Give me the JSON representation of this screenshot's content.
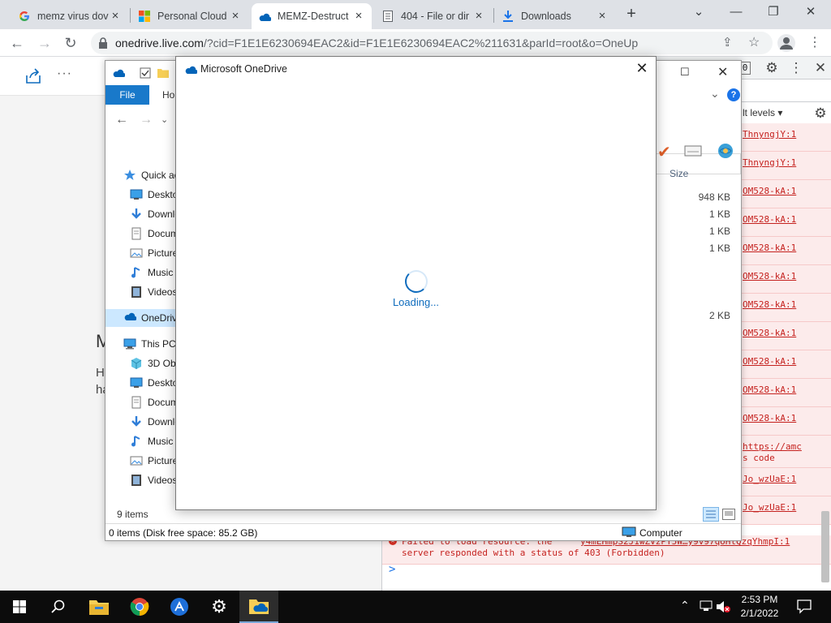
{
  "browser": {
    "tabs": [
      {
        "title": "memz virus dov",
        "icon": "google-icon"
      },
      {
        "title": "Personal Cloud",
        "icon": "microsoft-icon"
      },
      {
        "title": "MEMZ-Destruct",
        "icon": "onedrive-icon"
      },
      {
        "title": "404 - File or dir",
        "icon": "page-icon"
      },
      {
        "title": "Downloads",
        "icon": "download-icon"
      }
    ],
    "new_tab": "+",
    "url_host": "onedrive.live.com",
    "url_rest": "/?cid=F1E1E6230694EAC2&id=F1E1E6230694EAC2%211631&parId=root&o=OneUp"
  },
  "onedrive_page": {
    "heading": "M",
    "text1": "H",
    "text2": "ha"
  },
  "devtools": {
    "badge": "0",
    "levels": "lt levels",
    "log_links": [
      "ThnyngjY:1",
      "ThnyngjY:1",
      "OM528-kA:1",
      "OM528-kA:1",
      "OM528-kA:1",
      "OM528-kA:1",
      "OM528-kA:1",
      "OM528-kA:1",
      "OM528-kA:1",
      "OM528-kA:1",
      "OM528-kA:1"
    ],
    "extra_link1": "https://amc",
    "extra_link1b": "s code",
    "extra_link2": "Jo_wzUaE:1",
    "extra_link3": "Jo_wzUaE:1",
    "error_line1": "Failed to load resource: the",
    "error_line2": "server responded with a status of 403 (Forbidden)",
    "error_source": "y4mEHmpS2J1wZVzPT5W…y9v97qUHtQzqYhmpI:1",
    "prompt": ">"
  },
  "explorer": {
    "file_tab": "File",
    "home_tab": "Ho",
    "nav": [
      {
        "label": "Quick ac",
        "icon": "star-icon"
      },
      {
        "label": "Deskto",
        "icon": "desktop-icon"
      },
      {
        "label": "Downlo",
        "icon": "download-icon"
      },
      {
        "label": "Docum",
        "icon": "document-icon"
      },
      {
        "label": "Picture",
        "icon": "pictures-icon"
      },
      {
        "label": "Music",
        "icon": "music-icon"
      },
      {
        "label": "Videos",
        "icon": "videos-icon"
      },
      {
        "label": "OneDriv",
        "icon": "onedrive-icon"
      },
      {
        "label": "This PC",
        "icon": "computer-icon"
      },
      {
        "label": "3D Obj",
        "icon": "cube-icon"
      },
      {
        "label": "Deskto",
        "icon": "desktop-icon"
      },
      {
        "label": "Docum",
        "icon": "document-icon"
      },
      {
        "label": "Downlo",
        "icon": "download-icon"
      },
      {
        "label": "Music",
        "icon": "music-icon"
      },
      {
        "label": "Picture",
        "icon": "pictures-icon"
      },
      {
        "label": "Videos",
        "icon": "videos-icon"
      }
    ],
    "size_header": "Size",
    "sizes": [
      "948 KB",
      "1 KB",
      "1 KB",
      "1 KB",
      "2 KB"
    ],
    "item_count": "9 items",
    "status": "0 items (Disk free space: 85.2 GB)",
    "computer_label": "Computer"
  },
  "dialog": {
    "title": "Microsoft OneDrive",
    "loading": "Loading..."
  },
  "taskbar": {
    "time": "2:53 PM",
    "date": "2/1/2022",
    "apps": [
      "start-icon",
      "search-icon",
      "file-explorer-icon",
      "chrome-icon",
      "malware-app-icon",
      "settings-icon",
      "onedrive-folder-icon"
    ]
  }
}
